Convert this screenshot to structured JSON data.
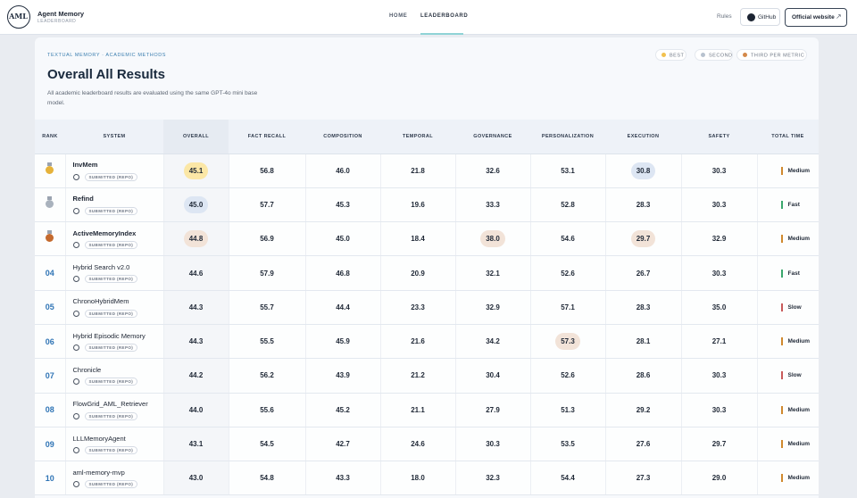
{
  "brand": {
    "logo_text": "AML",
    "title": "Agent Memory",
    "subtitle": "LEADERBOARD"
  },
  "nav": {
    "home": "HOME",
    "leaderboard": "LEADERBOARD",
    "rules": "Rules",
    "github": "GitHub",
    "official_website": "Official website",
    "external_arrow": "↗"
  },
  "header": {
    "breadcrumb": "TEXTUAL MEMORY · ACADEMIC METHODS",
    "title": "Overall All Results",
    "description": "All academic leaderboard results are evaluated using the same GPT-4o mini base model."
  },
  "legend": [
    {
      "label": "BEST",
      "color": "#f2c14e"
    },
    {
      "label": "SECOND",
      "color": "#b8c2cf"
    },
    {
      "label": "THIRD PER METRIC",
      "color": "#d4894a"
    }
  ],
  "colors": {
    "best": "#fbe7a6",
    "second": "#dde6f3",
    "third": "#f2e3d8",
    "fast": "#3aa76d",
    "medium": "#d0892e",
    "slow": "#c85a5a",
    "rank": "#2f74b5"
  },
  "table": {
    "columns": [
      "RANK",
      "SYSTEM",
      "OVERALL",
      "FACT RECALL",
      "COMPOSITION",
      "TEMPORAL",
      "GOVERNANCE",
      "PERSONALIZATION",
      "EXECUTION",
      "SAFETY",
      "TOTAL TIME"
    ],
    "submitted_label": "SUBMITTED (REPO)",
    "rows": [
      {
        "rank": "",
        "medal": "gold",
        "system": "InvMem",
        "overall": "45.1",
        "fact_recall": "56.8",
        "composition": "46.0",
        "temporal": "21.8",
        "governance": "32.6",
        "personalization": "53.1",
        "execution": "30.8",
        "safety": "30.3",
        "time": "Medium",
        "highlights": {
          "overall": "best",
          "execution": "second"
        }
      },
      {
        "rank": "",
        "medal": "silver",
        "system": "Refind",
        "overall": "45.0",
        "fact_recall": "57.7",
        "composition": "45.3",
        "temporal": "19.6",
        "governance": "33.3",
        "personalization": "52.8",
        "execution": "28.3",
        "safety": "30.3",
        "time": "Fast",
        "highlights": {
          "overall": "second"
        }
      },
      {
        "rank": "",
        "medal": "bronze",
        "system": "ActiveMemoryIndex",
        "overall": "44.8",
        "fact_recall": "56.9",
        "composition": "45.0",
        "temporal": "18.4",
        "governance": "38.0",
        "personalization": "54.6",
        "execution": "29.7",
        "safety": "32.9",
        "time": "Medium",
        "highlights": {
          "overall": "third",
          "governance": "third",
          "execution": "third"
        }
      },
      {
        "rank": "04",
        "medal": "",
        "system": "Hybrid Search v2.0",
        "overall": "44.6",
        "fact_recall": "57.9",
        "composition": "46.8",
        "temporal": "20.9",
        "governance": "32.1",
        "personalization": "52.6",
        "execution": "26.7",
        "safety": "30.3",
        "time": "Fast",
        "highlights": {}
      },
      {
        "rank": "05",
        "medal": "",
        "system": "ChronoHybridMem",
        "overall": "44.3",
        "fact_recall": "55.7",
        "composition": "44.4",
        "temporal": "23.3",
        "governance": "32.9",
        "personalization": "57.1",
        "execution": "28.3",
        "safety": "35.0",
        "time": "Slow",
        "highlights": {}
      },
      {
        "rank": "06",
        "medal": "",
        "system": "Hybrid Episodic Memory",
        "overall": "44.3",
        "fact_recall": "55.5",
        "composition": "45.9",
        "temporal": "21.6",
        "governance": "34.2",
        "personalization": "57.3",
        "execution": "28.1",
        "safety": "27.1",
        "time": "Medium",
        "highlights": {
          "personalization": "third"
        }
      },
      {
        "rank": "07",
        "medal": "",
        "system": "Chronicle",
        "overall": "44.2",
        "fact_recall": "56.2",
        "composition": "43.9",
        "temporal": "21.2",
        "governance": "30.4",
        "personalization": "52.6",
        "execution": "28.6",
        "safety": "30.3",
        "time": "Slow",
        "highlights": {}
      },
      {
        "rank": "08",
        "medal": "",
        "system": "FlowGrid_AML_Retriever",
        "overall": "44.0",
        "fact_recall": "55.6",
        "composition": "45.2",
        "temporal": "21.1",
        "governance": "27.9",
        "personalization": "51.3",
        "execution": "29.2",
        "safety": "30.3",
        "time": "Medium",
        "highlights": {}
      },
      {
        "rank": "09",
        "medal": "",
        "system": "LLLMemoryAgent",
        "overall": "43.1",
        "fact_recall": "54.5",
        "composition": "42.7",
        "temporal": "24.6",
        "governance": "30.3",
        "personalization": "53.5",
        "execution": "27.6",
        "safety": "29.7",
        "time": "Medium",
        "highlights": {}
      },
      {
        "rank": "10",
        "medal": "",
        "system": "aml-memory-mvp",
        "overall": "43.0",
        "fact_recall": "54.8",
        "composition": "43.3",
        "temporal": "18.0",
        "governance": "32.3",
        "personalization": "54.4",
        "execution": "27.3",
        "safety": "29.0",
        "time": "Medium",
        "highlights": {}
      }
    ]
  }
}
